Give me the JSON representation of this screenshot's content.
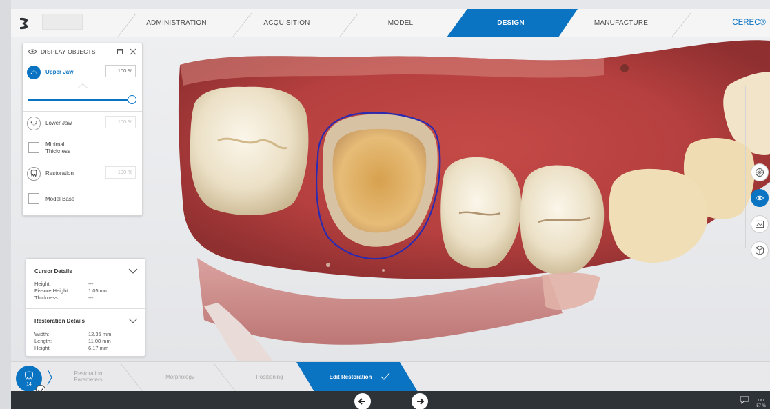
{
  "nav": {
    "tabs": [
      "ADMINISTRATION",
      "ACQUISITION",
      "MODEL",
      "DESIGN",
      "MANUFACTURE"
    ],
    "active_tab": "DESIGN",
    "brand": "CEREC®"
  },
  "display_objects": {
    "title": "DISPLAY OBJECTS",
    "upper_jaw": {
      "label": "Upper Jaw",
      "opacity": "100 %"
    },
    "slider_level": 1.0,
    "lower_jaw": {
      "label": "Lower Jaw",
      "opacity": "100 %"
    },
    "minimal_thickness": {
      "label_line1": "Minimal",
      "label_line2": "Thickness"
    },
    "restoration": {
      "label": "Restoration",
      "opacity": "100 %"
    },
    "model_base": {
      "label": "Model Base"
    }
  },
  "cursor_details": {
    "title": "Cursor Details",
    "rows": [
      {
        "label": "Height:",
        "value": "---"
      },
      {
        "label": "Fissure Height:",
        "value": "1.05 mm"
      },
      {
        "label": "Thickness:",
        "value": "---"
      }
    ]
  },
  "restoration_details": {
    "title": "Restoration Details",
    "rows": [
      {
        "label": "Width:",
        "value": "12.35 mm"
      },
      {
        "label": "Length:",
        "value": "11.08 mm"
      },
      {
        "label": "Height:",
        "value": "6.17 mm"
      }
    ]
  },
  "workflow": {
    "tooth_number": "14",
    "steps": [
      {
        "line1": "Restoration",
        "line2": "Parameters"
      },
      {
        "line1": "Morphology",
        "line2": ""
      },
      {
        "line1": "Positioning",
        "line2": ""
      },
      {
        "line1": "Edit Restoration",
        "line2": ""
      }
    ]
  },
  "status": {
    "zoom": "57 %"
  },
  "colors": {
    "accent": "#0a73c2",
    "margin_line": "#2a2bb0",
    "status_bar": "#2e3338"
  },
  "icons": [
    "logo-icon",
    "eye-icon",
    "upper-jaw-icon",
    "lower-jaw-icon",
    "tooth-icon",
    "chevron-down-icon",
    "tooth-view-icon",
    "image-icon",
    "cube-icon",
    "arrow-left-icon",
    "arrow-right-icon",
    "chat-icon",
    "checkmark-icon"
  ]
}
